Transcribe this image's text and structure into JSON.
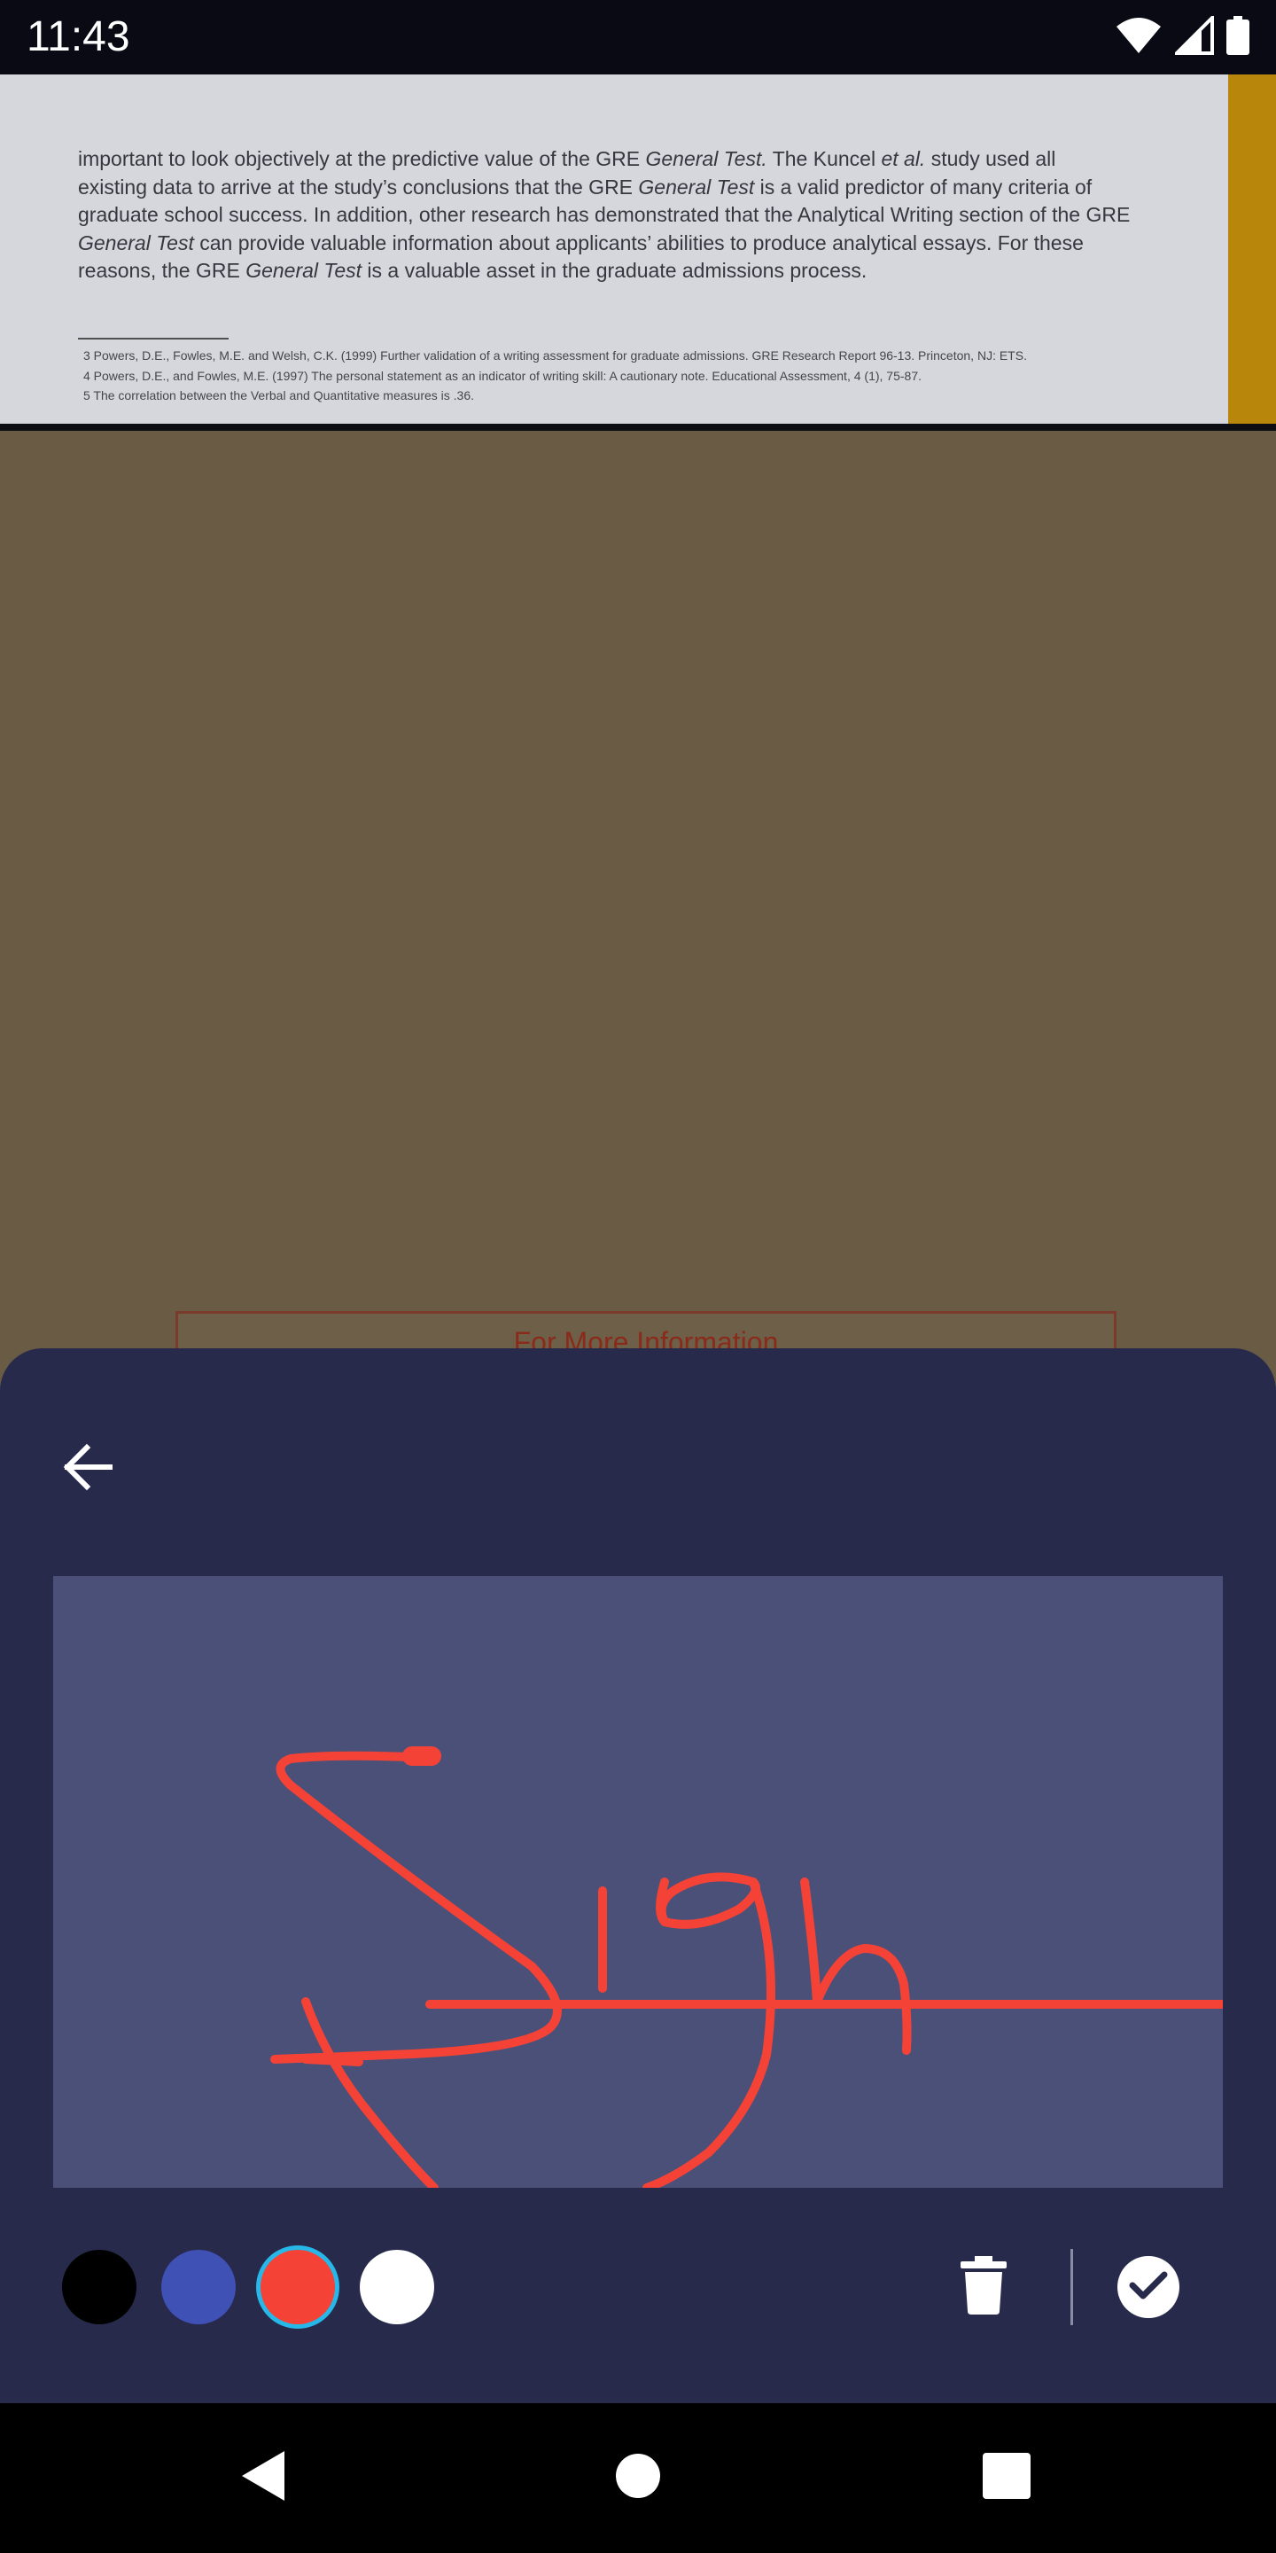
{
  "status_bar": {
    "time": "11:43",
    "icons": [
      "wifi-icon",
      "cell-signal-icon",
      "battery-icon"
    ]
  },
  "document": {
    "paragraph_lines": [
      [
        {
          "t": "important to look objectively at the predictive value of the GRE "
        },
        {
          "t": "General Test.",
          "i": true
        },
        {
          "t": " The Kuncel "
        },
        {
          "t": "et al.",
          "i": true
        },
        {
          "t": " study used all"
        }
      ],
      [
        {
          "t": "existing data to arrive at the study’s conclusions that the GRE "
        },
        {
          "t": "General Test",
          "i": true
        },
        {
          "t": " is a valid predictor of many criteria of"
        }
      ],
      [
        {
          "t": "graduate school success. In addition, other research has demonstrated that the Analytical Writing section of the GRE"
        }
      ],
      [
        {
          "t": "General Test",
          "i": true
        },
        {
          "t": " can provide valuable information about applicants’ abilities to produce analytical essays. For these"
        }
      ],
      [
        {
          "t": "reasons, the GRE "
        },
        {
          "t": "General Test",
          "i": true
        },
        {
          "t": " is a valuable asset in the graduate admissions process."
        }
      ]
    ],
    "footnotes": [
      "3  Powers, D.E., Fowles, M.E. and Welsh, C.K. (1999) Further validation of a writing assessment for graduate admissions. GRE Research Report 96-13.  Princeton, NJ:  ETS.",
      "4  Powers, D.E., and Fowles, M.E.  (1997) The personal statement as an indicator of writing skill: A cautionary note. Educational Assessment, 4 (1), 75-87.",
      "5  The correlation between the Verbal and Quantitative measures is .36."
    ],
    "info_box_title": "For More Information"
  },
  "signature_sheet": {
    "back_icon": "arrow-left-icon",
    "ink_color": "#f44336",
    "colors": [
      {
        "name": "black",
        "hex": "#000000",
        "selected": false
      },
      {
        "name": "blue",
        "hex": "#3f51b5",
        "selected": false
      },
      {
        "name": "red",
        "hex": "#f44336",
        "selected": true
      },
      {
        "name": "white",
        "hex": "#ffffff",
        "selected": false
      }
    ],
    "delete_icon": "trash-icon",
    "confirm_icon": "check-circle-icon"
  },
  "nav_bar": {
    "icons": [
      "back-triangle-icon",
      "home-circle-icon",
      "recents-square-icon"
    ]
  }
}
